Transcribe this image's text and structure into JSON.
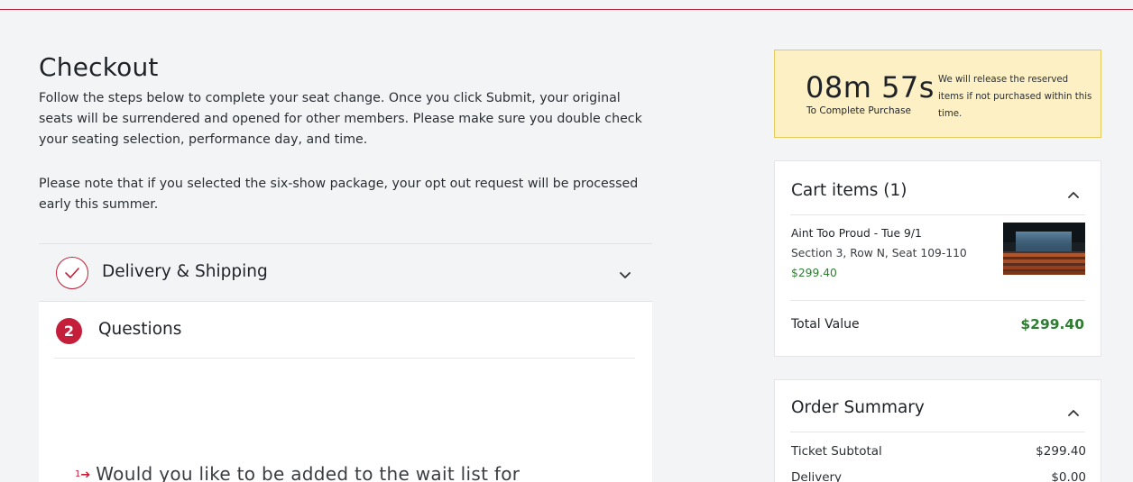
{
  "checkout": {
    "title": "Checkout",
    "intro": "Follow the steps below to complete your seat change.  Once you click Submit, your original seats will be surrendered and opened for other members.  Please make sure you double check your seating selection, performance day, and time.",
    "note": "Please note that if you selected the six-show package, your opt out request will be processed early this summer."
  },
  "steps": {
    "delivery": {
      "label": "Delivery & Shipping",
      "status_icon": "check-circle-icon"
    },
    "questions": {
      "number": "2",
      "label": "Questions",
      "question_number": "1",
      "question_text": "Would you like to be added to the wait list for"
    }
  },
  "timer": {
    "value": "08m 57s",
    "caption": "To Complete Purchase",
    "note": "We will release the reserved items if not purchased within this time."
  },
  "cart": {
    "title": "Cart items (1)",
    "item": {
      "name": "Aint Too Proud - Tue 9/1",
      "seat": "Section 3, Row N, Seat 109-110",
      "price": "$299.40"
    },
    "total_label": "Total Value",
    "total_value": "$299.40"
  },
  "summary": {
    "title": "Order Summary",
    "rows": [
      {
        "label": "Ticket Subtotal",
        "value": "$299.40"
      },
      {
        "label": "Delivery",
        "value": "$0.00"
      }
    ]
  },
  "colors": {
    "accent": "#c41e3a",
    "price_green": "#2e7d32",
    "timer_bg": "#fcf0c4"
  }
}
